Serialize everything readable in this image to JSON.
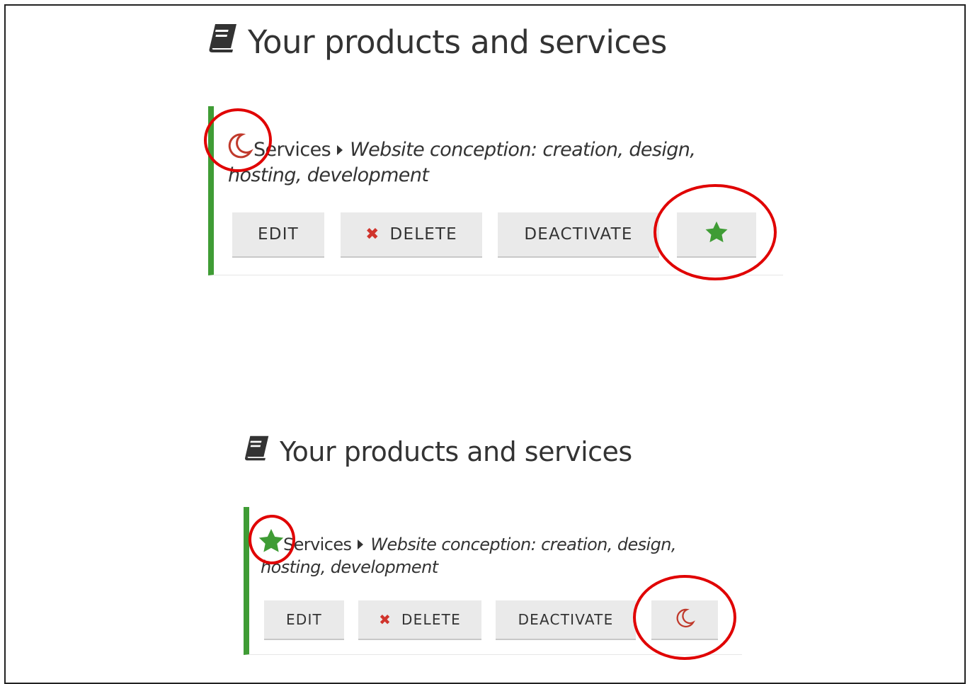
{
  "panels": [
    {
      "title": "Your products and services",
      "category": "Services",
      "service_line1": "Website conception: creation, design,",
      "service_line2": "hosting, development",
      "status_icon": "moon-icon",
      "buttons": {
        "edit": "EDIT",
        "delete": "DELETE",
        "deactivate": "DEACTIVATE",
        "toggle_icon": "star-icon"
      }
    },
    {
      "title": "Your products and services",
      "category": "Services",
      "service_line1": "Website conception: creation, design,",
      "service_line2": "hosting, development",
      "status_icon": "star-icon",
      "buttons": {
        "edit": "EDIT",
        "delete": "DELETE",
        "deactivate": "DEACTIVATE",
        "toggle_icon": "moon-icon"
      }
    }
  ],
  "colors": {
    "accent_green": "#3f9c35",
    "delete_red": "#d0342c",
    "annotation_red": "#e00000",
    "moon_red": "#c0392b"
  }
}
